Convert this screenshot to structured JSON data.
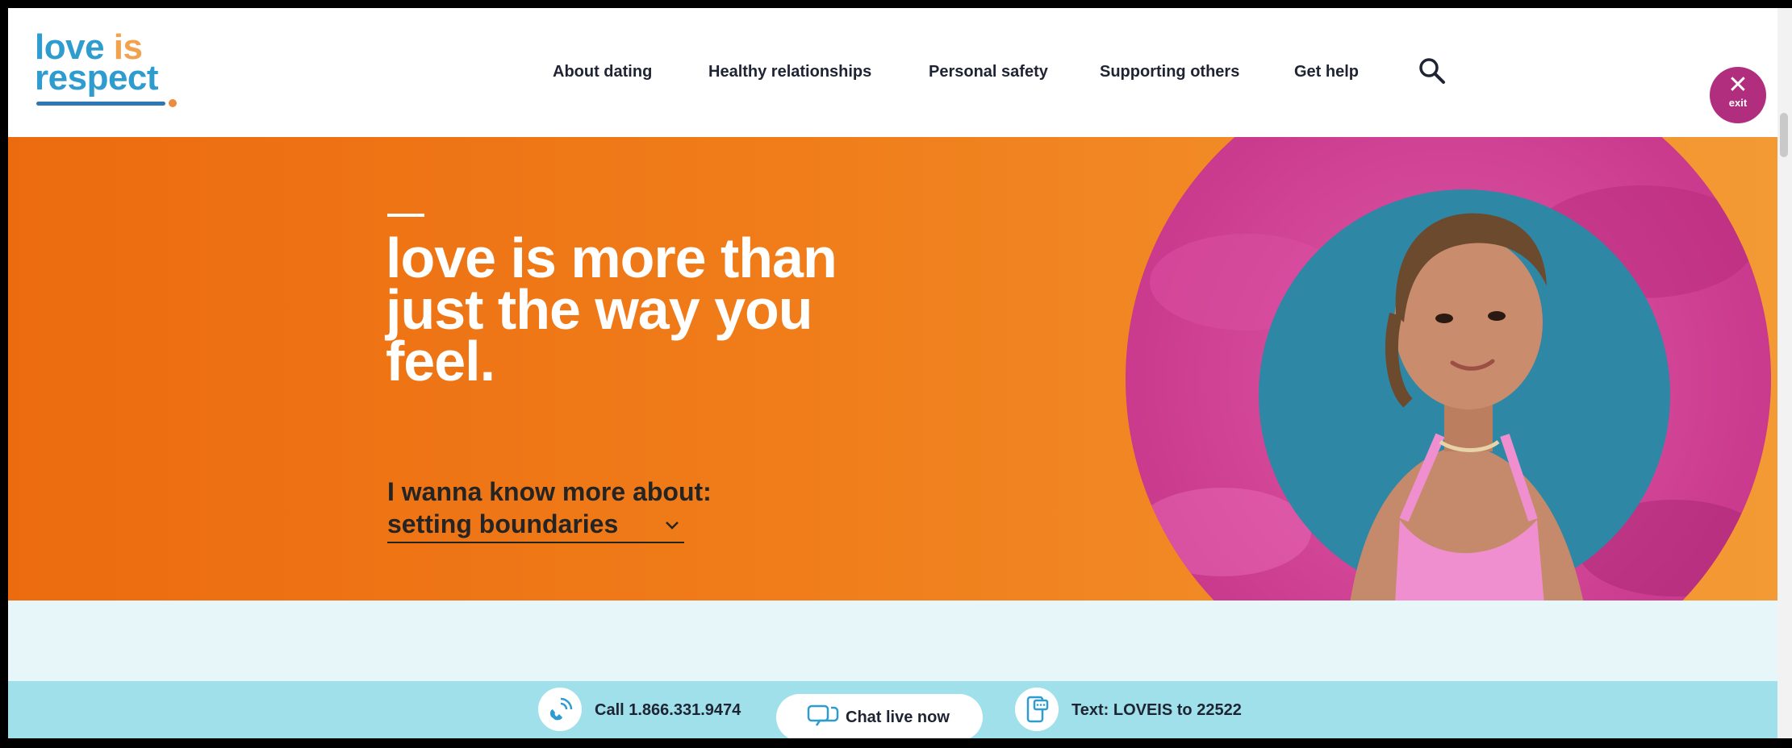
{
  "logo": {
    "line1_a": "love ",
    "line1_b": "is",
    "line2": "respect"
  },
  "nav": {
    "items": [
      {
        "label": "About dating"
      },
      {
        "label": "Healthy relationships"
      },
      {
        "label": "Personal safety"
      },
      {
        "label": "Supporting others"
      },
      {
        "label": "Get help"
      }
    ],
    "search_icon": "search-icon"
  },
  "exit": {
    "symbol": "✕",
    "label": "exit"
  },
  "hero": {
    "title": "love is more than just the way you feel.",
    "prompt": "I wanna know more about:",
    "dropdown_value": "setting boundaries"
  },
  "contact": {
    "call_label": "Call 1.866.331.9474",
    "chat_label": "Chat live now",
    "text_label": "Text: LOVEIS to 22522"
  },
  "colors": {
    "hero_orange": "#ec6b0f",
    "brand_blue": "#2e9ccf",
    "exit_magenta": "#b12e7f",
    "contact_bar": "#9fe0ea"
  }
}
